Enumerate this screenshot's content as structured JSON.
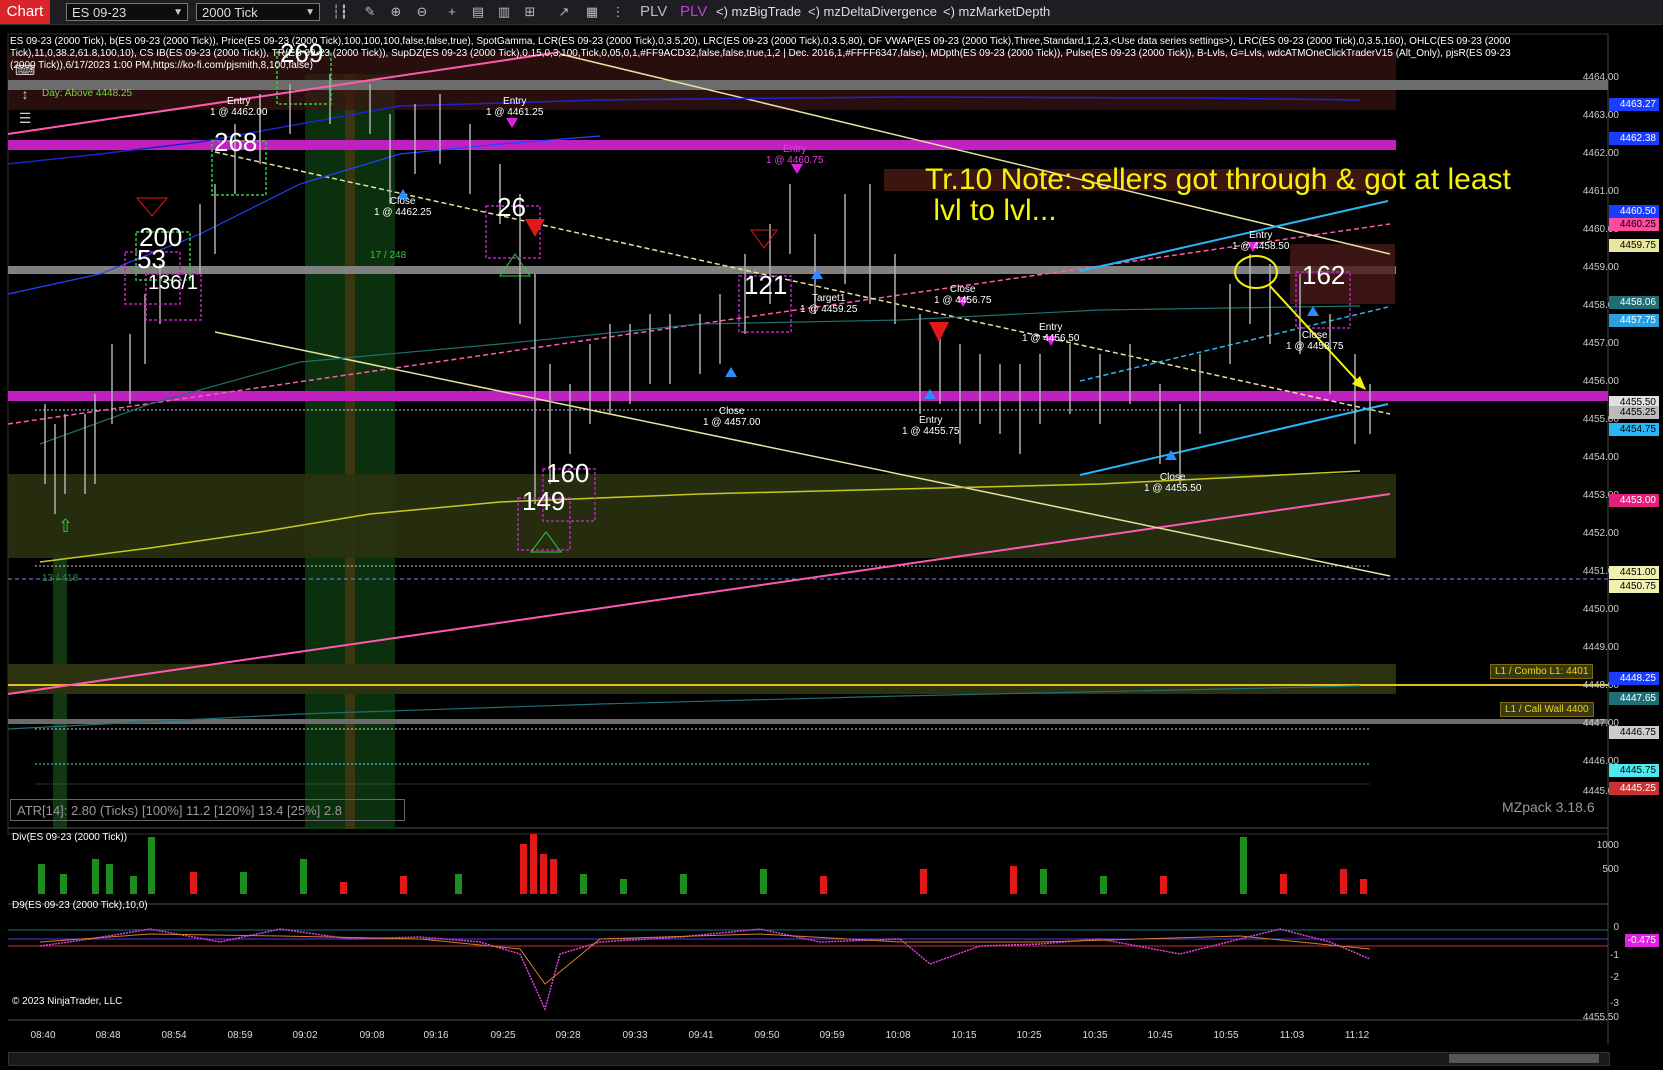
{
  "toolbar": {
    "chart_tab": "Chart",
    "instrument": "ES 09-23",
    "bar_type": "2000 Tick",
    "plv1": "PLV",
    "plv2": "PLV",
    "addon1": "<)  mzBigTrade",
    "addon2": "<)  mzDeltaDivergence",
    "addon3": "<)  mzMarketDepth"
  },
  "info_line": "ES 09-23 (2000 Tick), b(ES 09-23 (2000 Tick)), Price(ES 09-23 (2000 Tick),100,100,100,false,false,true), SpotGamma, LCR(ES 09-23 (2000 Tick),0,3.5,20), LRC(ES 09-23 (2000 Tick),0,3.5,80), OF VWAP(ES 09-23 (2000 Tick),Three,Standard,1,2,3,<Use data series settings>), LRC(ES 09-23 (2000 Tick),0,3.5,160), OHLC(ES 09-23 (2000 Tick),11,0,38.2,61.8,100,10), CS IB(ES 09-23 (2000 Tick)), TR(ES 09-23 (2000 Tick)), SupDZ(ES 09-23 (2000 Tick),0,15,0,3,100,Tick,0,05,0,1,#FF9ACD32,false,false,true,1,2 | Dec. 2016,1,#FFFF6347,false), MDpth(ES 09-23 (2000 Tick)), Pulse(ES 09-23 (2000 Tick)), B-Lvls, G=Lvls, wdcATMOneClickTraderV15 (Alt_Only), pjsR(ES 09-23 (2000 Tick)),6/17/2023 1:00 PM,https://ko-fi.com/pjsmith,8,100,false)",
  "day_above": "Day: Above 4448.25",
  "note": {
    "line1": "Tr.10 Note: sellers got through & got at least",
    "line2": " lvl to lvl..."
  },
  "price_axis": [
    "4464.00",
    "4463.00",
    "4462.00",
    "4461.00",
    "4460.00",
    "4459.00",
    "4458.00",
    "4457.00",
    "4456.00",
    "4455.00",
    "4454.00",
    "4453.00",
    "4452.00",
    "4451.00",
    "4450.00",
    "4449.00",
    "4448.00",
    "4447.00",
    "4446.00",
    "4445.00"
  ],
  "price_tags": [
    {
      "text": "4463.27",
      "bg": "#1a3cff",
      "fg": "#fff"
    },
    {
      "text": "4462.38",
      "bg": "#1a3cff",
      "fg": "#fff"
    },
    {
      "text": "4460.50",
      "bg": "#1a3cff",
      "fg": "#fff"
    },
    {
      "text": "4460.25",
      "bg": "#ff4aa0",
      "fg": "#000"
    },
    {
      "text": "4459.75",
      "bg": "#e7e7a0",
      "fg": "#000"
    },
    {
      "text": "4458.06",
      "bg": "#1e6e78",
      "fg": "#fff"
    },
    {
      "text": "4457.75",
      "bg": "#2aa0e0",
      "fg": "#fff"
    },
    {
      "text": "4455.50",
      "bg": "#e0e0e0",
      "fg": "#000"
    },
    {
      "text": "4455.25",
      "bg": "#bbbbbb",
      "fg": "#000"
    },
    {
      "text": "4454.75",
      "bg": "#29b6f6",
      "fg": "#000"
    },
    {
      "text": "4453.00",
      "bg": "#e0207a",
      "fg": "#fff"
    },
    {
      "text": "4451.00",
      "bg": "#f0f0b0",
      "fg": "#000"
    },
    {
      "text": "4450.75",
      "bg": "#f0f0b0",
      "fg": "#000"
    },
    {
      "text": "4448.25",
      "bg": "#1a3cff",
      "fg": "#fff"
    },
    {
      "text": "4447.65",
      "bg": "#1e6e78",
      "fg": "#fff"
    },
    {
      "text": "4446.75",
      "bg": "#cccccc",
      "fg": "#000"
    },
    {
      "text": "4445.75",
      "bg": "#4ee8f0",
      "fg": "#000"
    },
    {
      "text": "4445.25",
      "bg": "#c83232",
      "fg": "#fff"
    }
  ],
  "level_labels": {
    "combo": "L1 / Combo L1: 4401",
    "call_wall": "L1 / Call Wall 4400"
  },
  "trade_labels": [
    {
      "text": "Entry\n1 @ 4462.00"
    },
    {
      "text": "Entry\n1 @ 4461.25"
    },
    {
      "text": "Close\n1 @ 4462.25"
    },
    {
      "text": "Entry\n1 @ 4460.75"
    },
    {
      "text": "Target1\n1 @ 4459.25"
    },
    {
      "text": "Close\n1 @ 4456.75"
    },
    {
      "text": "Entry\n1 @ 4456.50"
    },
    {
      "text": "Entry\n1 @ 4455.75"
    },
    {
      "text": "Close\n1 @ 4457.00"
    },
    {
      "text": "Entry\n1 @ 4458.50"
    },
    {
      "text": "Close\n1 @ 4458.75"
    },
    {
      "text": "Close\n1 @ 4455.50"
    }
  ],
  "big_numbers": [
    "268",
    "200",
    "53",
    "136/1",
    "26",
    "121",
    "160",
    "149",
    "162",
    "269"
  ],
  "small_labels": {
    "a": "17 / 248",
    "b": "13 / 418"
  },
  "atr": "ATR[14]: 2.80 (Ticks) [100%] 11.2  [120%] 13.4  [25%] 2.8",
  "mzpack": "MZpack 3.18.6",
  "div_panel": {
    "title": "Div(ES 09-23 (2000 Tick))",
    "ticks": [
      "1000",
      "500"
    ]
  },
  "d9_panel": {
    "title": "D9(ES 09-23 (2000 Tick),10,0)",
    "ticks": [
      "0",
      "-0.475",
      "-1",
      "-2",
      "-3",
      "4455.50"
    ]
  },
  "copyright": "© 2023 NinjaTrader, LLC",
  "time_axis": [
    "08:40",
    "08:48",
    "08:54",
    "08:59",
    "09:02",
    "09:08",
    "09:16",
    "09:25",
    "09:28",
    "09:33",
    "09:41",
    "09:50",
    "09:59",
    "10:08",
    "10:15",
    "10:25",
    "10:35",
    "10:45",
    "10:55",
    "11:03",
    "11:12"
  ],
  "colors": {
    "magenta": "#c020c0",
    "yellow": "#f4f40a",
    "up": "#1e8c1e",
    "down": "#e01818"
  }
}
